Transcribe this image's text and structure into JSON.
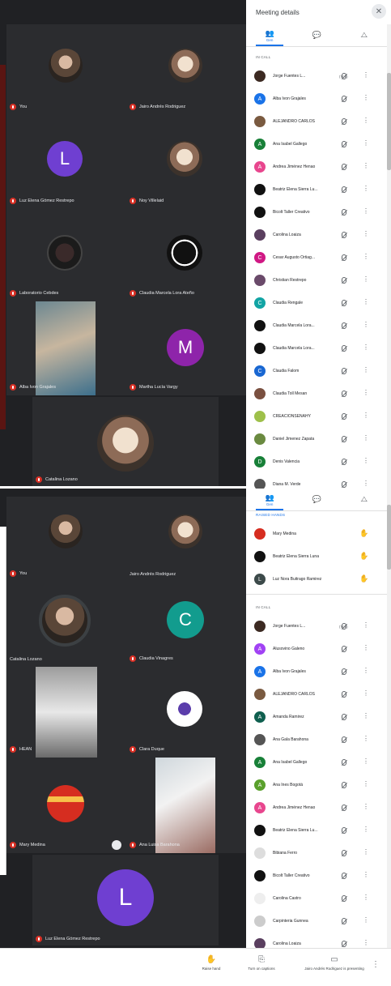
{
  "top": {
    "tiles": [
      {
        "name": "You"
      },
      {
        "name": "Jairo Andrés Rodriguez"
      },
      {
        "name": "Luz Elena Gómez Restrepo",
        "initial": "L"
      },
      {
        "name": "Noy Villelaid"
      },
      {
        "name": "Laboratorio Cebdes"
      },
      {
        "name": "Claudia Marcela Lora Ateño"
      },
      {
        "name": "Alba Ivon Grajales"
      },
      {
        "name": "Martha Lucía Vargy",
        "initial": "M"
      },
      {
        "name": "Catalina Lozano"
      }
    ],
    "panel": {
      "title": "Meeting details",
      "close": "✕",
      "tab_people": "Gen",
      "section_in_call": "IN CALL",
      "participants": [
        {
          "name": "Jorge Fuentes L...",
          "tag": "(You)",
          "color": "#3c2a22"
        },
        {
          "name": "Alba Ivon Grajales",
          "initial": "A",
          "color": "#1a73e8"
        },
        {
          "name": "ALEJANDRO CARLOS",
          "color": "#7a5a40"
        },
        {
          "name": "Ana Isabel Gallego",
          "initial": "A",
          "color": "#188038"
        },
        {
          "name": "Andrea Jiménez Henao",
          "initial": "A",
          "color": "#e8468e"
        },
        {
          "name": "Beatriz Elena Sierra Lu...",
          "color": "#111111"
        },
        {
          "name": "Bicolt Taller Creativo",
          "color": "#111111"
        },
        {
          "name": "Carolina Loaiza",
          "color": "#5a3f5f"
        },
        {
          "name": "Cesar Augusto Ortiag...",
          "initial": "C",
          "color": "#d01884"
        },
        {
          "name": "Christian Restrepo",
          "color": "#6a4a6a"
        },
        {
          "name": "Claudia Rengale",
          "initial": "C",
          "color": "#12a4a4"
        },
        {
          "name": "Claudia Marcela Lora...",
          "color": "#111111"
        },
        {
          "name": "Claudia Marcela Lora...",
          "color": "#111111"
        },
        {
          "name": "Claudia Falom",
          "initial": "C",
          "color": "#1967d2"
        },
        {
          "name": "Claudia Toll Mesan",
          "color": "#7a5040"
        },
        {
          "name": "CREACIONSENAHY",
          "color": "#9ec04a"
        },
        {
          "name": "Daniel Jimenez Zapata",
          "color": "#6a8a40"
        },
        {
          "name": "Denis Valencia",
          "initial": "D",
          "color": "#188038"
        },
        {
          "name": "Diana M. Verde",
          "color": "#555555"
        }
      ]
    }
  },
  "bottom": {
    "tiles": [
      {
        "name": "You"
      },
      {
        "name": "Jairo Andrés Rodriguez"
      },
      {
        "name": "Catalina Lozano"
      },
      {
        "name": "Claudia Vinagres",
        "initial": "C"
      },
      {
        "name": "HEAN"
      },
      {
        "name": "Clara Duque"
      },
      {
        "name": "Mary Medina"
      },
      {
        "name": "Ana Luisa Barahona"
      },
      {
        "name": "Luz Elena Gómez Restrepo",
        "initial": "L"
      }
    ],
    "panel": {
      "tab_people": "Gen",
      "section_raised": "RAISED HANDS",
      "raised": [
        {
          "name": "Mary Medina",
          "color": "#d62d20"
        },
        {
          "name": "Beatriz Elena Sierra Luna",
          "color": "#111111"
        },
        {
          "name": "Luz Nora Buitrago Ramirez",
          "initial": "L",
          "color": "#3c4a4a"
        }
      ],
      "section_in_call": "IN CALL",
      "participants": [
        {
          "name": "Jorge Fuentes L...",
          "tag": "(You)",
          "color": "#3c2a22"
        },
        {
          "name": "Alusovino Galeno",
          "initial": "A",
          "color": "#a142f4"
        },
        {
          "name": "Alba Ivon Grajales",
          "initial": "A",
          "color": "#1a73e8"
        },
        {
          "name": "ALEJANDRO CARLOS",
          "color": "#7a5a40"
        },
        {
          "name": "Amanda Ramirez",
          "initial": "A",
          "color": "#0f5f4f"
        },
        {
          "name": "Ana Gala Barahona",
          "color": "#555555"
        },
        {
          "name": "Ana Isabel Gallego",
          "initial": "A",
          "color": "#188038"
        },
        {
          "name": "Ana Ines Bogotá",
          "initial": "A",
          "color": "#5aa02c"
        },
        {
          "name": "Andrea Jiménez Henao",
          "initial": "A",
          "color": "#e8468e"
        },
        {
          "name": "Beatriz Elena Sierra Lu...",
          "color": "#111111"
        },
        {
          "name": "Bibiana Ferro",
          "color": "#dddddd"
        },
        {
          "name": "Bicolt Taller Creativo",
          "color": "#111111"
        },
        {
          "name": "Carolina Castro",
          "color": "#eeeeee"
        },
        {
          "name": "Carpinteria Gunnea",
          "color": "#cccccc"
        },
        {
          "name": "Carolina Loaiza",
          "color": "#5a3f5f"
        }
      ]
    }
  },
  "bottombar": {
    "raise_hand": "Raise hand",
    "captions": "Turn on captions",
    "presenting": "Jairo Andrés Rodriguez is presenting",
    "more": "⋮"
  }
}
